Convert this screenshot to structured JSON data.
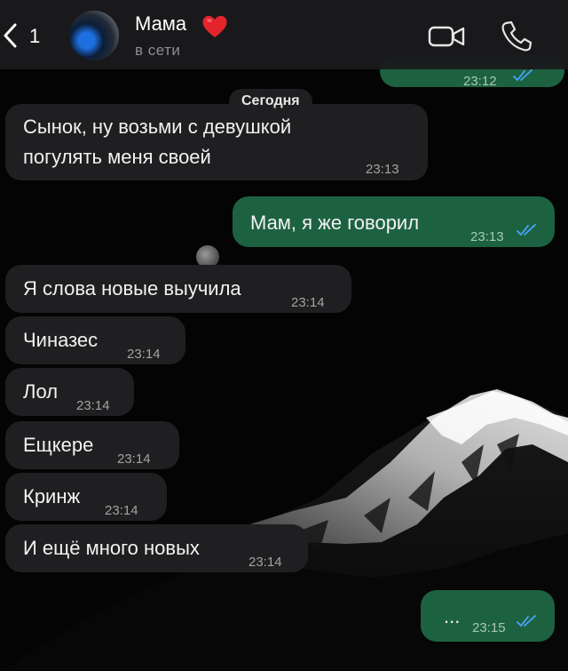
{
  "header": {
    "back_count": "1",
    "contact_name": "Мама",
    "status": "в сети",
    "heart_emoji_icon": "red-heart-icon",
    "video_icon": "video-camera-icon",
    "call_icon": "phone-icon"
  },
  "top_partial_time": "23:12",
  "date_label": "Сегодня",
  "messages": [
    {
      "dir": "in",
      "line1": "Сынок, ну возьми с девушкой",
      "line2": "погулять меня своей",
      "time": "23:13"
    },
    {
      "dir": "out",
      "text": "Мам, я же говорил",
      "time": "23:13",
      "read": true
    },
    {
      "dir": "in",
      "text": "Я слова новые выучила",
      "time": "23:14"
    },
    {
      "dir": "in",
      "text": "Чиназес",
      "time": "23:14"
    },
    {
      "dir": "in",
      "text": "Лол",
      "time": "23:14"
    },
    {
      "dir": "in",
      "text": "Ещкере",
      "time": "23:14"
    },
    {
      "dir": "in",
      "text": "Кринж",
      "time": "23:14"
    },
    {
      "dir": "in",
      "text": "И ещё много новых",
      "time": "23:14"
    },
    {
      "dir": "out",
      "text": "...",
      "time": "23:15",
      "read": true
    }
  ],
  "colors": {
    "incoming_bubble": "#1f1f21",
    "outgoing_bubble": "#1d6240",
    "read_ticks": "#4aa3ff",
    "heart": "#e3242b"
  }
}
